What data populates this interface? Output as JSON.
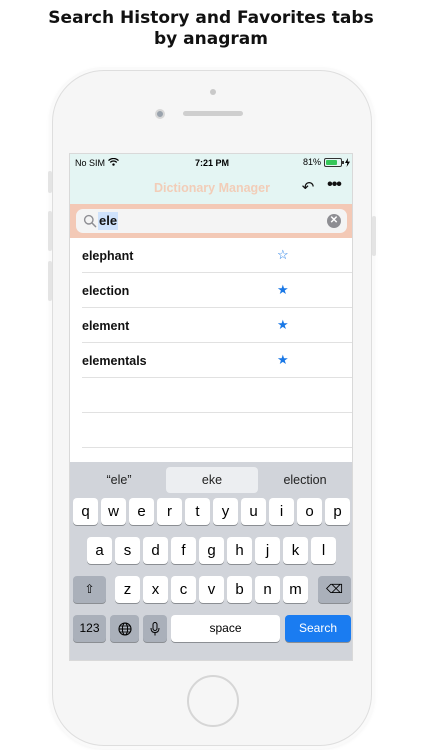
{
  "caption": {
    "line1": "Search History and Favorites tabs",
    "line2": "by anagram"
  },
  "status_bar": {
    "carrier": "No SIM",
    "time": "7:21 PM",
    "battery_percent": "81%",
    "battery_level": 0.81
  },
  "nav": {
    "title": "Dictionary Manager",
    "undo_icon": "undo-icon",
    "more_icon": "more-icon",
    "more_glyph": "•••",
    "undo_glyph": "↶"
  },
  "search": {
    "value": "ele",
    "clear_glyph": "✕"
  },
  "results": [
    {
      "word": "elephant",
      "favorite": false,
      "star": "☆"
    },
    {
      "word": "election",
      "favorite": true,
      "star": "★"
    },
    {
      "word": "element",
      "favorite": true,
      "star": "★"
    },
    {
      "word": "elementals",
      "favorite": true,
      "star": "★"
    }
  ],
  "keyboard": {
    "suggestions": [
      "“ele”",
      "eke",
      "election"
    ],
    "row1": [
      "q",
      "w",
      "e",
      "r",
      "t",
      "y",
      "u",
      "i",
      "o",
      "p"
    ],
    "row2": [
      "a",
      "s",
      "d",
      "f",
      "g",
      "h",
      "j",
      "k",
      "l"
    ],
    "row3": [
      "z",
      "x",
      "c",
      "v",
      "b",
      "n",
      "m"
    ],
    "shift_glyph": "⇧",
    "delete_glyph": "⌫",
    "numbers_label": "123",
    "globe_glyph": "🌐",
    "mic_glyph": "🎤",
    "space_label": "space",
    "search_label": "Search"
  },
  "colors": {
    "nav_bg": "#e4f5f3",
    "title_color": "#f2cdb8",
    "search_bar_bg": "#f3c9b6",
    "star_color": "#1a78e6",
    "search_key": "#1a7cf1"
  }
}
